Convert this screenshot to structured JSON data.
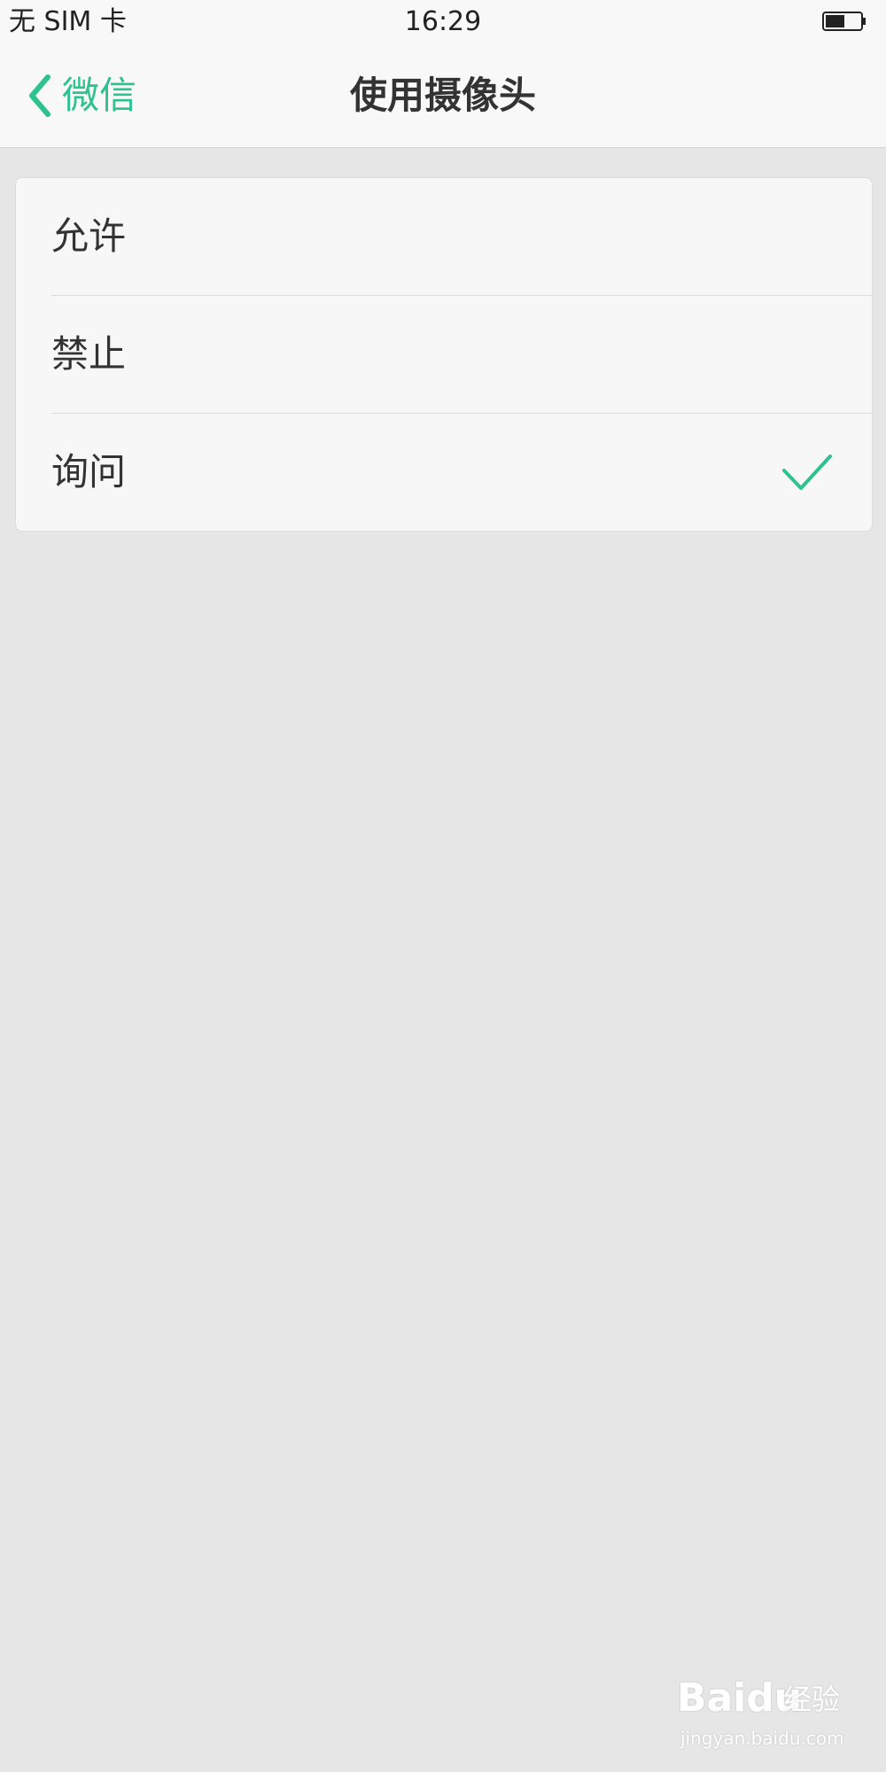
{
  "status_bar": {
    "carrier": "无 SIM 卡",
    "time": "16:29",
    "battery_level": 0.55
  },
  "nav": {
    "back_label": "微信",
    "title": "使用摄像头"
  },
  "options": [
    {
      "label": "允许",
      "selected": false
    },
    {
      "label": "禁止",
      "selected": false
    },
    {
      "label": "询问",
      "selected": true
    }
  ],
  "watermark": {
    "brand": "Baidu",
    "jingyan": "经验",
    "url": "jingyan.baidu.com"
  },
  "colors": {
    "accent": "#2ec28e",
    "background": "#e6e6e6",
    "card": "#f7f7f7",
    "bar": "#f8f8f8"
  }
}
